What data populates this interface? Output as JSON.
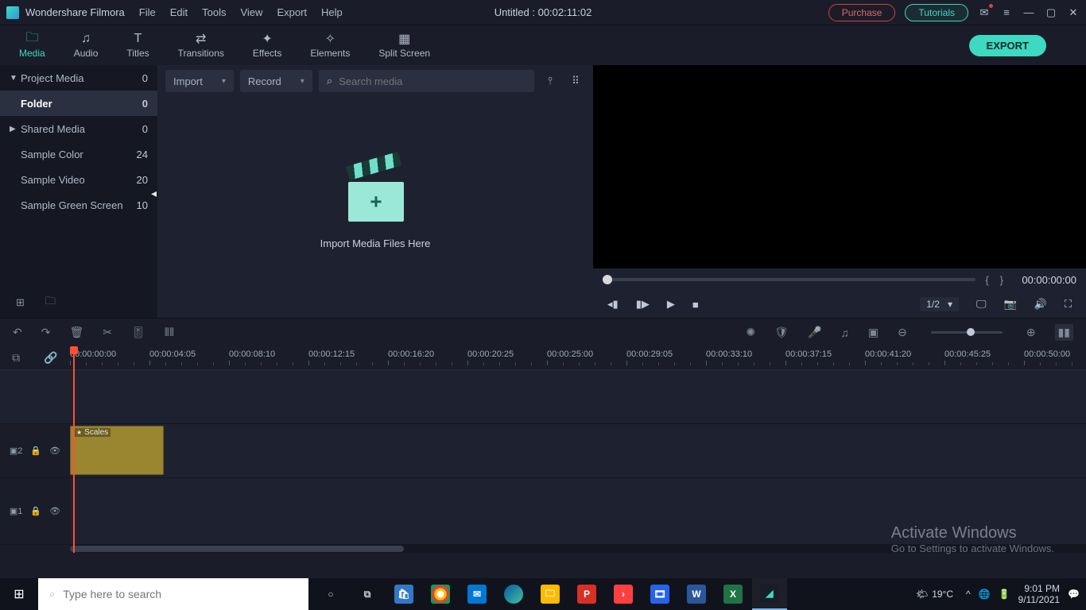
{
  "title": {
    "app": "Wondershare Filmora",
    "doc": "Untitled : 00:02:11:02"
  },
  "menu": [
    "File",
    "Edit",
    "Tools",
    "View",
    "Export",
    "Help"
  ],
  "topbtns": {
    "purchase": "Purchase",
    "tutorials": "Tutorials"
  },
  "tabs": [
    {
      "label": "Media",
      "active": true,
      "icon": "▭"
    },
    {
      "label": "Audio",
      "active": false,
      "icon": "♫"
    },
    {
      "label": "Titles",
      "active": false,
      "icon": "T"
    },
    {
      "label": "Transitions",
      "active": false,
      "icon": "⇄"
    },
    {
      "label": "Effects",
      "active": false,
      "icon": "✦"
    },
    {
      "label": "Elements",
      "active": false,
      "icon": "✧"
    },
    {
      "label": "Split Screen",
      "active": false,
      "icon": "▦"
    }
  ],
  "export_label": "EXPORT",
  "sidebar": [
    {
      "arrow": "▼",
      "label": "Project Media",
      "count": "0",
      "sel": false
    },
    {
      "arrow": "",
      "label": "Folder",
      "count": "0",
      "sel": true
    },
    {
      "arrow": "▶",
      "label": "Shared Media",
      "count": "0",
      "sel": false
    },
    {
      "arrow": "",
      "label": "Sample Color",
      "count": "24",
      "sel": false
    },
    {
      "arrow": "",
      "label": "Sample Video",
      "count": "20",
      "sel": false
    },
    {
      "arrow": "",
      "label": "Sample Green Screen",
      "count": "10",
      "sel": false
    }
  ],
  "media": {
    "import": "Import",
    "record": "Record",
    "search_ph": "Search media",
    "drop": "Import Media Files Here"
  },
  "preview": {
    "time": "00:00:00:00",
    "zoom": "1/2"
  },
  "ruler": [
    "00:00:00:00",
    "00:00:04:05",
    "00:00:08:10",
    "00:00:12:15",
    "00:00:16:20",
    "00:00:20:25",
    "00:00:25:00",
    "00:00:29:05",
    "00:00:33:10",
    "00:00:37:15",
    "00:00:41:20",
    "00:00:45:25",
    "00:00:50:00"
  ],
  "tracks": [
    {
      "name": "2",
      "clip": {
        "label": "Scales",
        "left": 0,
        "width": 118
      }
    },
    {
      "name": "1",
      "clip": null
    }
  ],
  "activate": {
    "l1": "Activate Windows",
    "l2": "Go to Settings to activate Windows."
  },
  "taskbar": {
    "search_ph": "Type here to search",
    "weather": "19°C",
    "time": "9:01 PM",
    "date": "9/11/2021"
  }
}
